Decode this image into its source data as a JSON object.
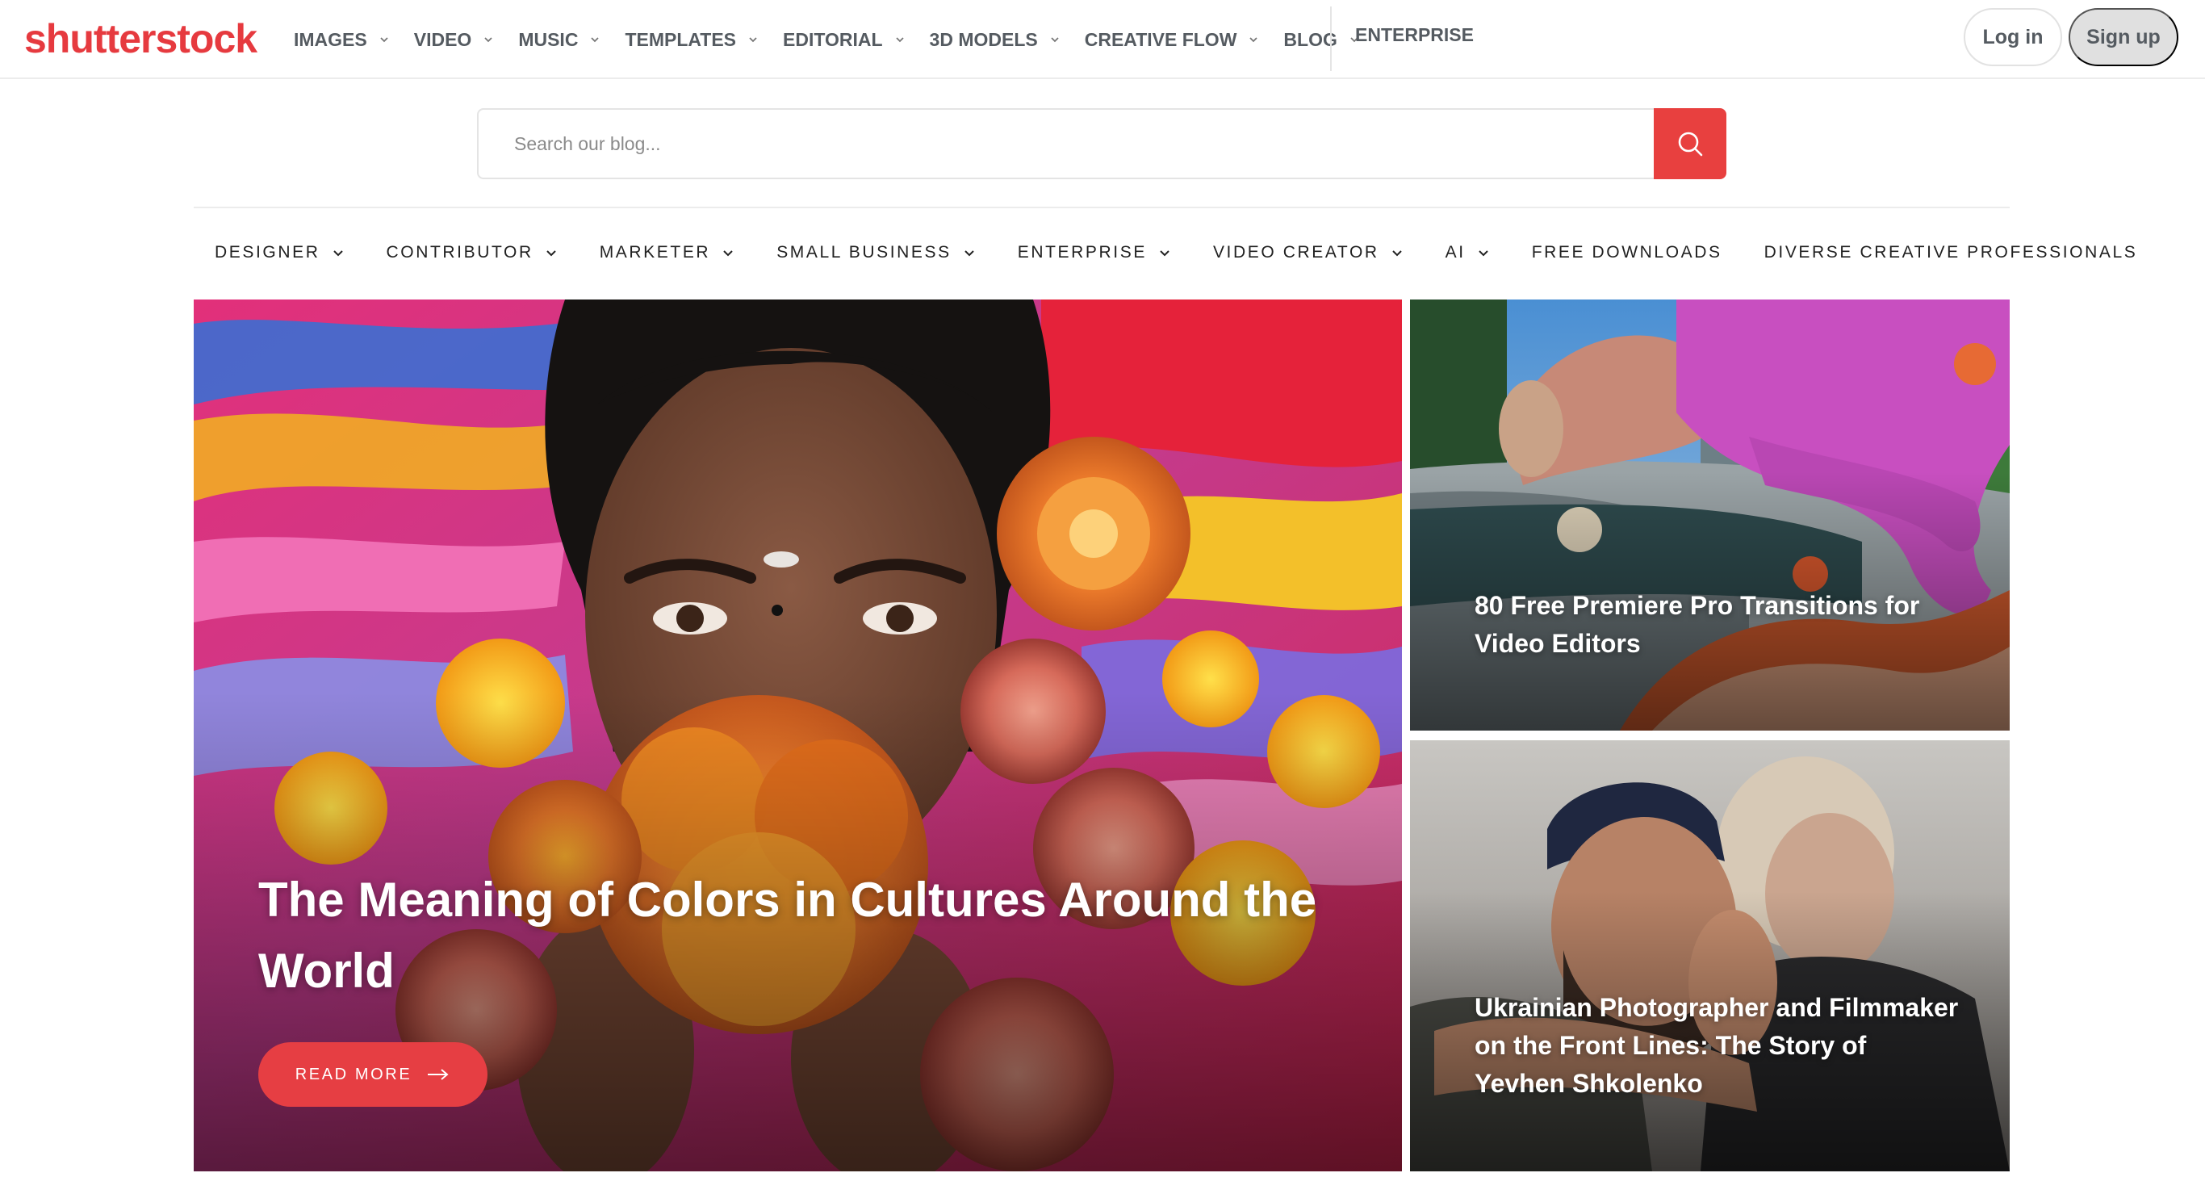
{
  "header": {
    "logo_text": "shutterstock",
    "nav": [
      {
        "label": "IMAGES"
      },
      {
        "label": "VIDEO"
      },
      {
        "label": "MUSIC"
      },
      {
        "label": "TEMPLATES"
      },
      {
        "label": "EDITORIAL"
      },
      {
        "label": "3D MODELS"
      },
      {
        "label": "CREATIVE FLOW"
      },
      {
        "label": "BLOG"
      }
    ],
    "enterprise_label": "ENTERPRISE",
    "login_label": "Log in",
    "signup_label": "Sign up"
  },
  "search": {
    "placeholder": "Search our blog...",
    "value": ""
  },
  "categories": [
    {
      "label": "DESIGNER",
      "has_dropdown": true
    },
    {
      "label": "CONTRIBUTOR",
      "has_dropdown": true
    },
    {
      "label": "MARKETER",
      "has_dropdown": true
    },
    {
      "label": "SMALL BUSINESS",
      "has_dropdown": true
    },
    {
      "label": "ENTERPRISE",
      "has_dropdown": true
    },
    {
      "label": "VIDEO CREATOR",
      "has_dropdown": true
    },
    {
      "label": "AI",
      "has_dropdown": true
    },
    {
      "label": "FREE DOWNLOADS",
      "has_dropdown": false
    },
    {
      "label": "DIVERSE CREATIVE PROFESSIONALS",
      "has_dropdown": false
    }
  ],
  "featured": {
    "title": "The Meaning of Colors in Cultures Around the World",
    "read_more_label": "READ MORE"
  },
  "side_posts": [
    {
      "title": "80 Free Premiere Pro Transitions for Video Editors"
    },
    {
      "title": "Ukrainian Photographer and Filmmaker on the Front Lines: The Story of Yevhen Shkolenko"
    }
  ],
  "colors": {
    "brand_red": "#e63a3f",
    "search_button": "#e8403f",
    "nav_text": "#555b61",
    "signup_bg": "#e0e0e0"
  }
}
